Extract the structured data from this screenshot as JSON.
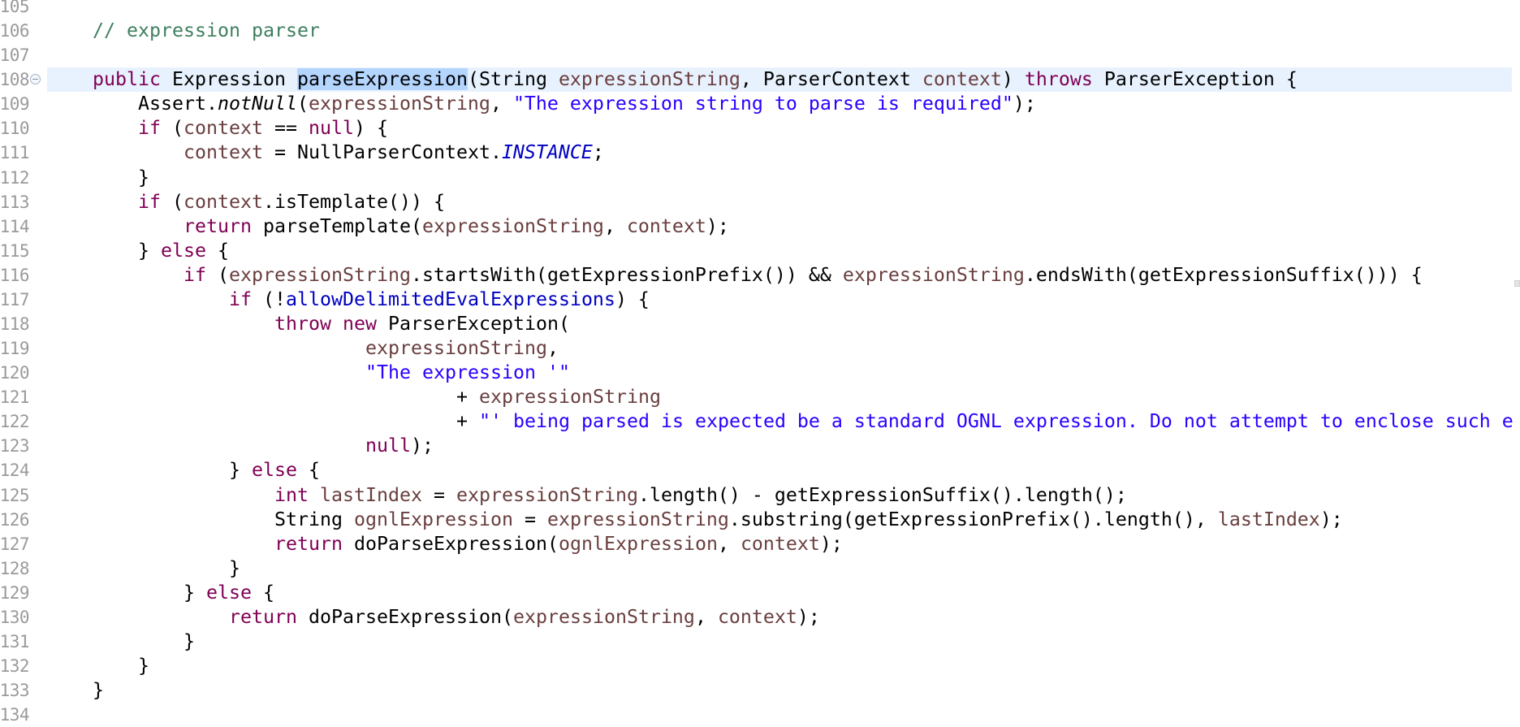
{
  "editor": {
    "current_line": 108,
    "selected_text": "parseExpression",
    "overview_ruler_marker_line": 116,
    "lines": [
      {
        "n": "105",
        "indent": 0,
        "tokens": []
      },
      {
        "n": "106",
        "indent": 0,
        "tokens": [
          [
            "com",
            "// expression parser"
          ]
        ]
      },
      {
        "n": "107",
        "indent": 0,
        "tokens": []
      },
      {
        "n": "108",
        "indent": 0,
        "fold": true,
        "tokens": [
          [
            "kw",
            "public"
          ],
          [
            "p",
            " Expression "
          ],
          [
            "sel",
            "parseExpression"
          ],
          [
            "p",
            "(String "
          ],
          [
            "var",
            "expressionString"
          ],
          [
            "p",
            ", ParserContext "
          ],
          [
            "var",
            "context"
          ],
          [
            "p",
            ") "
          ],
          [
            "kw",
            "throws"
          ],
          [
            "p",
            " ParserException {"
          ]
        ]
      },
      {
        "n": "109",
        "indent": 1,
        "tokens": [
          [
            "p",
            "Assert."
          ],
          [
            "smeth",
            "notNull"
          ],
          [
            "p",
            "("
          ],
          [
            "var",
            "expressionString"
          ],
          [
            "p",
            ", "
          ],
          [
            "str",
            "\"The expression string to parse is required\""
          ],
          [
            "p",
            ");"
          ]
        ]
      },
      {
        "n": "110",
        "indent": 1,
        "tokens": [
          [
            "kw",
            "if"
          ],
          [
            "p",
            " ("
          ],
          [
            "var",
            "context"
          ],
          [
            "p",
            " == "
          ],
          [
            "kw",
            "null"
          ],
          [
            "p",
            ") {"
          ]
        ]
      },
      {
        "n": "111",
        "indent": 2,
        "tokens": [
          [
            "var",
            "context"
          ],
          [
            "p",
            " = NullParserContext."
          ],
          [
            "static",
            "INSTANCE"
          ],
          [
            "p",
            ";"
          ]
        ]
      },
      {
        "n": "112",
        "indent": 1,
        "tokens": [
          [
            "p",
            "}"
          ]
        ]
      },
      {
        "n": "113",
        "indent": 1,
        "tokens": [
          [
            "kw",
            "if"
          ],
          [
            "p",
            " ("
          ],
          [
            "var",
            "context"
          ],
          [
            "p",
            ".isTemplate()) {"
          ]
        ]
      },
      {
        "n": "114",
        "indent": 2,
        "tokens": [
          [
            "kw",
            "return"
          ],
          [
            "p",
            " parseTemplate("
          ],
          [
            "var",
            "expressionString"
          ],
          [
            "p",
            ", "
          ],
          [
            "var",
            "context"
          ],
          [
            "p",
            ");"
          ]
        ]
      },
      {
        "n": "115",
        "indent": 1,
        "tokens": [
          [
            "p",
            "} "
          ],
          [
            "kw",
            "else"
          ],
          [
            "p",
            " {"
          ]
        ]
      },
      {
        "n": "116",
        "indent": 2,
        "tokens": [
          [
            "kw",
            "if"
          ],
          [
            "p",
            " ("
          ],
          [
            "var",
            "expressionString"
          ],
          [
            "p",
            ".startsWith(getExpressionPrefix()) && "
          ],
          [
            "var",
            "expressionString"
          ],
          [
            "p",
            ".endsWith(getExpressionSuffix())) {"
          ]
        ]
      },
      {
        "n": "117",
        "indent": 3,
        "tokens": [
          [
            "kw",
            "if"
          ],
          [
            "p",
            " (!"
          ],
          [
            "field",
            "allowDelimitedEvalExpressions"
          ],
          [
            "p",
            ") {"
          ]
        ]
      },
      {
        "n": "118",
        "indent": 4,
        "tokens": [
          [
            "kw",
            "throw"
          ],
          [
            "p",
            " "
          ],
          [
            "kw",
            "new"
          ],
          [
            "p",
            " ParserException("
          ]
        ]
      },
      {
        "n": "119",
        "indent": 6,
        "tokens": [
          [
            "var",
            "expressionString"
          ],
          [
            "p",
            ","
          ]
        ]
      },
      {
        "n": "120",
        "indent": 6,
        "tokens": [
          [
            "str",
            "\"The expression '\""
          ]
        ]
      },
      {
        "n": "121",
        "indent": 8,
        "tokens": [
          [
            "p",
            "+ "
          ],
          [
            "var",
            "expressionString"
          ]
        ]
      },
      {
        "n": "122",
        "indent": 8,
        "tokens": [
          [
            "p",
            "+ "
          ],
          [
            "str",
            "\"' being parsed is expected be a standard OGNL expression. Do not attempt to enclose such e"
          ]
        ]
      },
      {
        "n": "123",
        "indent": 6,
        "tokens": [
          [
            "kw",
            "null"
          ],
          [
            "p",
            ");"
          ]
        ]
      },
      {
        "n": "124",
        "indent": 3,
        "tokens": [
          [
            "p",
            "} "
          ],
          [
            "kw",
            "else"
          ],
          [
            "p",
            " {"
          ]
        ]
      },
      {
        "n": "125",
        "indent": 4,
        "tokens": [
          [
            "kw",
            "int"
          ],
          [
            "p",
            " "
          ],
          [
            "var",
            "lastIndex"
          ],
          [
            "p",
            " = "
          ],
          [
            "var",
            "expressionString"
          ],
          [
            "p",
            ".length() - getExpressionSuffix().length();"
          ]
        ]
      },
      {
        "n": "126",
        "indent": 4,
        "tokens": [
          [
            "p",
            "String "
          ],
          [
            "var",
            "ognlExpression"
          ],
          [
            "p",
            " = "
          ],
          [
            "var",
            "expressionString"
          ],
          [
            "p",
            ".substring(getExpressionPrefix().length(), "
          ],
          [
            "var",
            "lastIndex"
          ],
          [
            "p",
            ");"
          ]
        ]
      },
      {
        "n": "127",
        "indent": 4,
        "tokens": [
          [
            "kw",
            "return"
          ],
          [
            "p",
            " doParseExpression("
          ],
          [
            "var",
            "ognlExpression"
          ],
          [
            "p",
            ", "
          ],
          [
            "var",
            "context"
          ],
          [
            "p",
            ");"
          ]
        ]
      },
      {
        "n": "128",
        "indent": 3,
        "tokens": [
          [
            "p",
            "}"
          ]
        ]
      },
      {
        "n": "129",
        "indent": 2,
        "tokens": [
          [
            "p",
            "} "
          ],
          [
            "kw",
            "else"
          ],
          [
            "p",
            " {"
          ]
        ]
      },
      {
        "n": "130",
        "indent": 3,
        "tokens": [
          [
            "kw",
            "return"
          ],
          [
            "p",
            " doParseExpression("
          ],
          [
            "var",
            "expressionString"
          ],
          [
            "p",
            ", "
          ],
          [
            "var",
            "context"
          ],
          [
            "p",
            ");"
          ]
        ]
      },
      {
        "n": "131",
        "indent": 2,
        "tokens": [
          [
            "p",
            "}"
          ]
        ]
      },
      {
        "n": "132",
        "indent": 1,
        "tokens": [
          [
            "p",
            "}"
          ]
        ]
      },
      {
        "n": "133",
        "indent": 0,
        "tokens": [
          [
            "p",
            "}"
          ]
        ]
      },
      {
        "n": "134",
        "indent": 0,
        "tokens": []
      }
    ]
  },
  "syntax_colors": {
    "keyword": "#7f0055",
    "string": "#2a00ff",
    "comment": "#3f7f5f",
    "local_variable": "#6a3e3e",
    "field": "#0000c0",
    "plain": "#000000",
    "current_line_highlight": "#e8f2fe",
    "selection": "#b4d5fe",
    "line_number": "#9a9a9a"
  },
  "icons": {
    "fold": "collapse-fold-icon"
  }
}
